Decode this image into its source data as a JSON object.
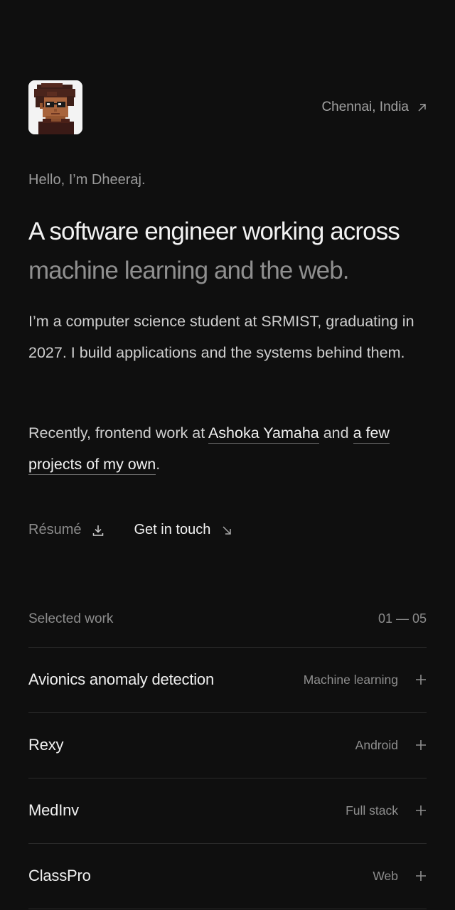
{
  "header": {
    "avatar_alt": "Pixel art portrait of Dheeraj",
    "location": "Chennai, India",
    "location_icon": "arrow-up-right-icon"
  },
  "intro": {
    "greeting": "Hello, I’m Dheeraj.",
    "headline_primary": "A software engineer working across",
    "headline_secondary": "machine learning and the web.",
    "bio": "I’m a computer science student at SRMIST, graduating in 2027. I build applications and the systems behind them.",
    "recent_prefix": "Recently, frontend work at ",
    "recent_link1": "Ashoka Yamaha",
    "recent_middle": " and ",
    "recent_link2": "a few projects of my own",
    "recent_suffix": "."
  },
  "actions": {
    "resume_label": "Résumé",
    "resume_icon": "download-icon",
    "contact_label": "Get in touch",
    "contact_icon": "arrow-down-right-icon"
  },
  "work": {
    "heading": "Selected work",
    "range": "01 — 05",
    "items": [
      {
        "title": "Avionics anomaly detection",
        "tag": "Machine learning"
      },
      {
        "title": "Rexy",
        "tag": "Android"
      },
      {
        "title": "MedInv",
        "tag": "Full stack"
      },
      {
        "title": "ClassPro",
        "tag": "Web"
      }
    ]
  },
  "colors": {
    "background": "#0f0f0f",
    "text_primary": "#f2f2f2",
    "text_muted": "#8f8f8f",
    "divider": "#2a2a2a"
  }
}
